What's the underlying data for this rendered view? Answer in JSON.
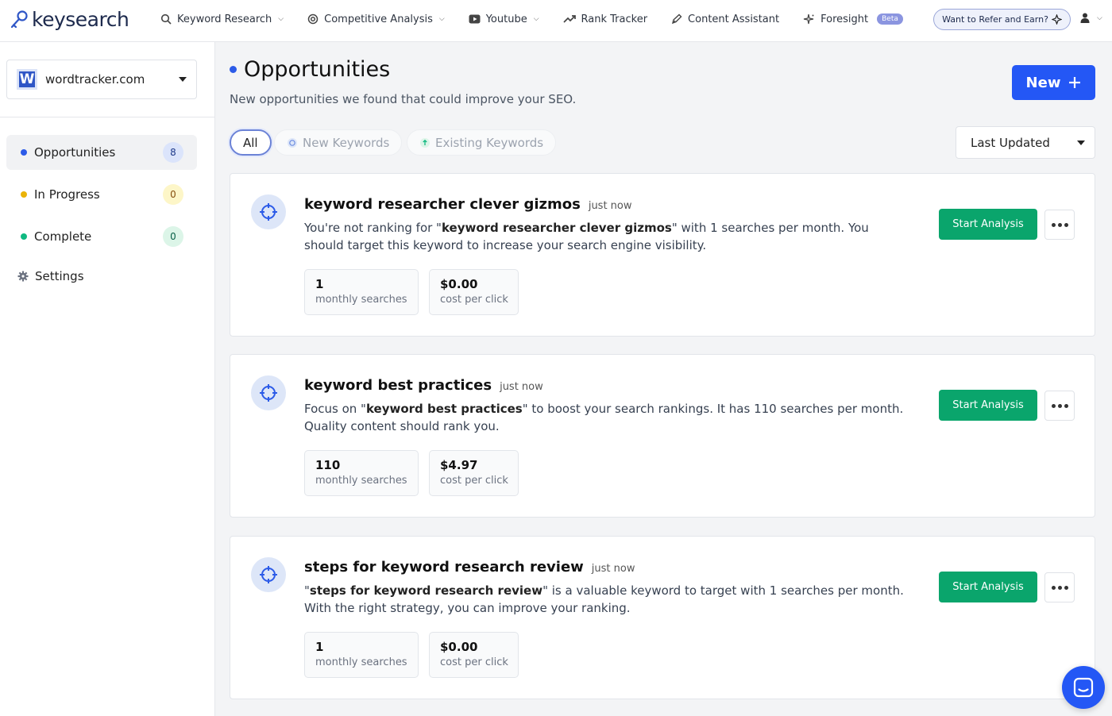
{
  "brand": {
    "name": "keysearch"
  },
  "nav": {
    "items": [
      {
        "label": "Keyword Research",
        "icon": "search-icon",
        "dropdown": true
      },
      {
        "label": "Competitive Analysis",
        "icon": "target-icon",
        "dropdown": true
      },
      {
        "label": "Youtube",
        "icon": "youtube-icon",
        "dropdown": true
      },
      {
        "label": "Rank Tracker",
        "icon": "trend-icon",
        "dropdown": false
      },
      {
        "label": "Content Assistant",
        "icon": "pen-icon",
        "dropdown": false
      },
      {
        "label": "Foresight",
        "icon": "sparkle-icon",
        "dropdown": false,
        "badge": "Beta"
      }
    ],
    "refer_label": "Want to Refer and Earn?"
  },
  "sidebar": {
    "site": "wordtracker.com",
    "site_logo_letter": "W",
    "items": [
      {
        "label": "Opportunities",
        "count": "8",
        "dot_color": "#2c5be8",
        "active": true
      },
      {
        "label": "In Progress",
        "count": "0",
        "dot_color": "#eab308"
      },
      {
        "label": "Complete",
        "count": "0",
        "dot_color": "#10b981"
      },
      {
        "label": "Settings",
        "icon": "gear-icon"
      }
    ]
  },
  "main": {
    "title": "Opportunities",
    "subtitle": "New opportunities we found that could improve your SEO.",
    "new_label": "New",
    "filters": [
      {
        "label": "All",
        "active": true
      },
      {
        "label": "New Keywords",
        "icon": "crosshair-icon"
      },
      {
        "label": "Existing Keywords",
        "icon": "arrow-up-icon"
      }
    ],
    "sort_label": "Last Updated",
    "cards": [
      {
        "keyword": "keyword researcher clever gizmos",
        "time": "just now",
        "desc_pre": "You're not ranking for \"",
        "desc_bold": "keyword researcher clever gizmos",
        "desc_post": "\" with 1 searches per month. You should target this keyword to increase your search engine visibility.",
        "searches": "1",
        "searches_label": "monthly searches",
        "cpc": "$0.00",
        "cpc_label": "cost per click",
        "action": "Start Analysis"
      },
      {
        "keyword": "keyword best practices",
        "time": "just now",
        "desc_pre": "Focus on \"",
        "desc_bold": "keyword best practices",
        "desc_post": "\" to boost your search rankings. It has 110 searches per month. Quality content should rank you.",
        "searches": "110",
        "searches_label": "monthly searches",
        "cpc": "$4.97",
        "cpc_label": "cost per click",
        "action": "Start Analysis"
      },
      {
        "keyword": "steps for keyword research review",
        "time": "just now",
        "desc_pre": "\"",
        "desc_bold": "steps for keyword research review",
        "desc_post": "\" is a valuable keyword to target with 1 searches per month. With the right strategy, you can improve your ranking.",
        "searches": "1",
        "searches_label": "monthly searches",
        "cpc": "$0.00",
        "cpc_label": "cost per click",
        "action": "Start Analysis"
      }
    ]
  }
}
